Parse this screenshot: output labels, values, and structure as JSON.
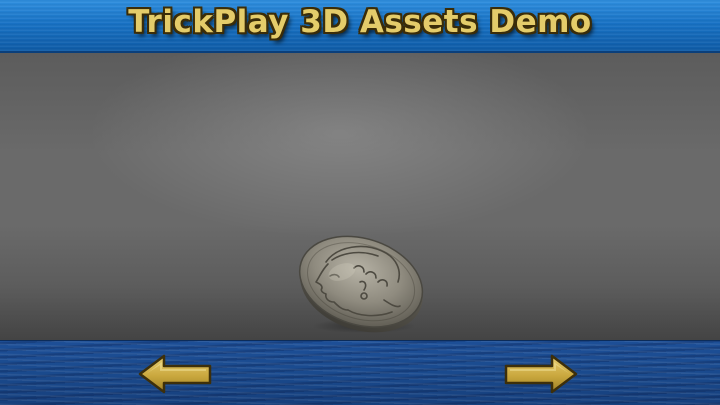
{
  "app": {
    "title": "TrickPlay 3D Assets Demo"
  },
  "colors": {
    "header_blue": "#1873c6",
    "title_gold": "#e4cc6a",
    "stage_gray": "#6a6a6a",
    "footer_blue": "#1a4a8d",
    "arrow_gold": "#d7b84e"
  },
  "asset": {
    "kind": "coin",
    "icon": "greek-coin-portrait"
  },
  "navigation": {
    "previous_icon": "arrow-left-icon",
    "next_icon": "arrow-right-icon"
  }
}
